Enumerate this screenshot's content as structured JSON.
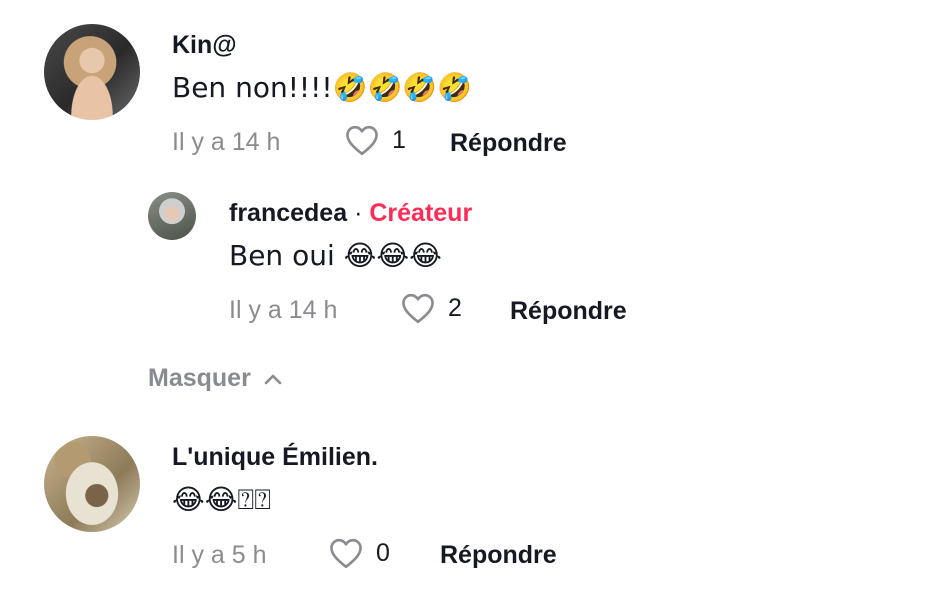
{
  "comments": [
    {
      "username": "Kin@",
      "text": "Ben non!!!!🤣🤣🤣🤣",
      "time": "Il y a 14 h",
      "likes": "1",
      "reply_label": "Répondre",
      "avatar_icon": "user-avatar-photo"
    },
    {
      "username": "francedea",
      "separator": "·",
      "badge": "Créateur",
      "text": "Ben oui 😂😂😂",
      "time": "Il y a 14 h",
      "likes": "2",
      "reply_label": "Répondre",
      "avatar_icon": "user-avatar-photo"
    },
    {
      "username": "L'unique Émilien.",
      "text": "😂😂⍰⍰",
      "time": "Il y a 5 h",
      "likes": "0",
      "reply_label": "Répondre",
      "avatar_icon": "bird-nest-photo"
    }
  ],
  "hide_replies_label": "Masquer",
  "icons": {
    "like": "heart-outline-icon",
    "collapse": "chevron-up-icon"
  },
  "colors": {
    "text": "#161823",
    "muted": "#8a8b91",
    "creator_badge": "#fe2c55",
    "background": "#ffffff"
  }
}
